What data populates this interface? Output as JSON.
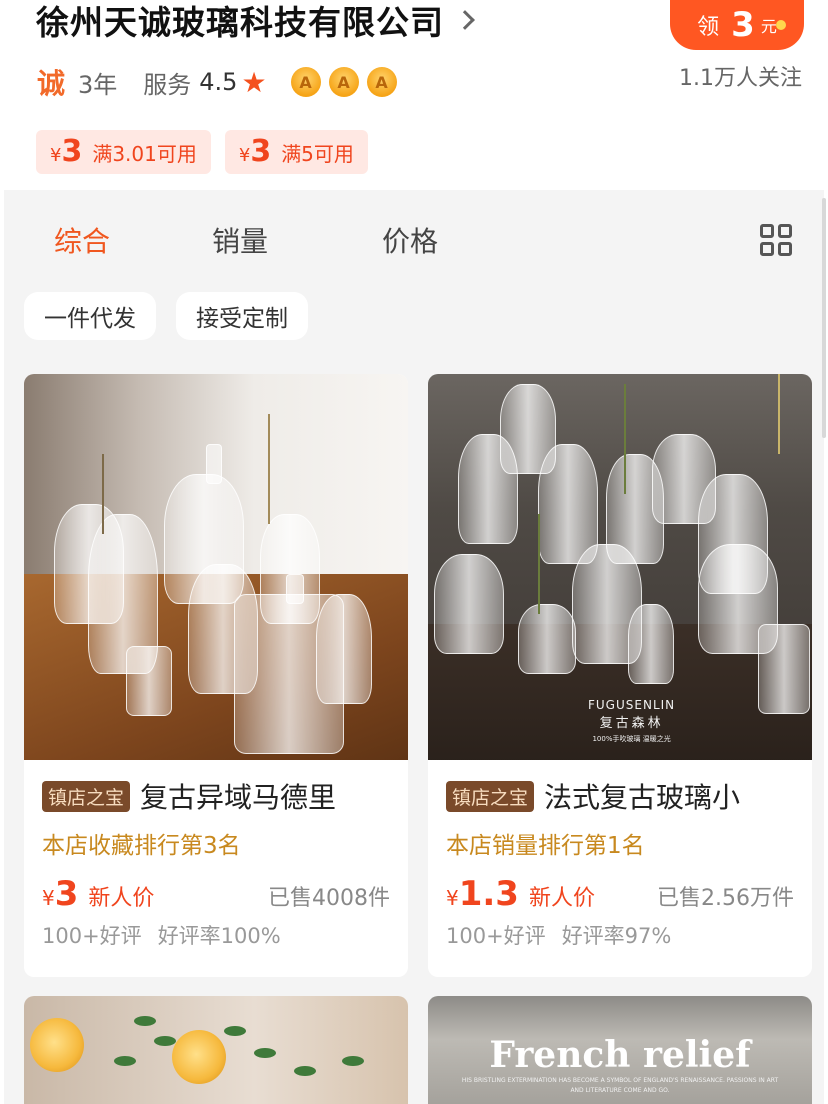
{
  "shop": {
    "name": "徐州天诚玻璃科技有限公司",
    "cheng_icon": "诚",
    "years": "3年",
    "service_label": "服务",
    "service_score": "4.5",
    "star_icon": "★",
    "badges": [
      "A",
      "A",
      "A"
    ],
    "followers": "1.1万人关注"
  },
  "coupon_button": {
    "lead": "领",
    "amount": "3",
    "unit": "元"
  },
  "tickets": [
    {
      "yen": "¥",
      "amount": "3",
      "condition": "满3.01可用"
    },
    {
      "yen": "¥",
      "amount": "3",
      "condition": "满5可用"
    }
  ],
  "sort_tabs": [
    "综合",
    "销量",
    "价格"
  ],
  "active_sort": "综合",
  "filters": [
    "一件代发",
    "接受定制"
  ],
  "products": [
    {
      "tag": "镇店之宝",
      "title": "复古异域马德里",
      "rank": "本店收藏排行第3名",
      "price_yen": "¥",
      "price": "3",
      "price_label": "新人价",
      "sold": "已售4008件",
      "reviews": "100+好评",
      "rating": "好评率100%"
    },
    {
      "tag": "镇店之宝",
      "title": "法式复古玻璃小",
      "rank": "本店销量排行第1名",
      "price_yen": "¥",
      "price": "1.3",
      "price_label": "新人价",
      "sold": "已售2.56万件",
      "reviews": "100+好评",
      "rating": "好评率97%",
      "image_text": {
        "brand": "FUGUSENLIN",
        "brand_cn": "复古森林",
        "tagline": "100%手吹玻璃 温暖之光"
      }
    },
    {
      "image_text": {}
    },
    {
      "image_text": {
        "headline": "French relief",
        "sub": "HIS BRISTLING EXTERMINATION HAS BECOME A SYMBOL OF ENGLAND'S RENAISSANCE. PASSIONS IN ART AND LITERATURE COME AND GO."
      }
    }
  ],
  "colors": {
    "accent": "#f0571f",
    "price": "#f0451e",
    "rank": "#c8891f",
    "tag_bg": "#7a4a2a",
    "page_bg": "#f4f4f4"
  }
}
